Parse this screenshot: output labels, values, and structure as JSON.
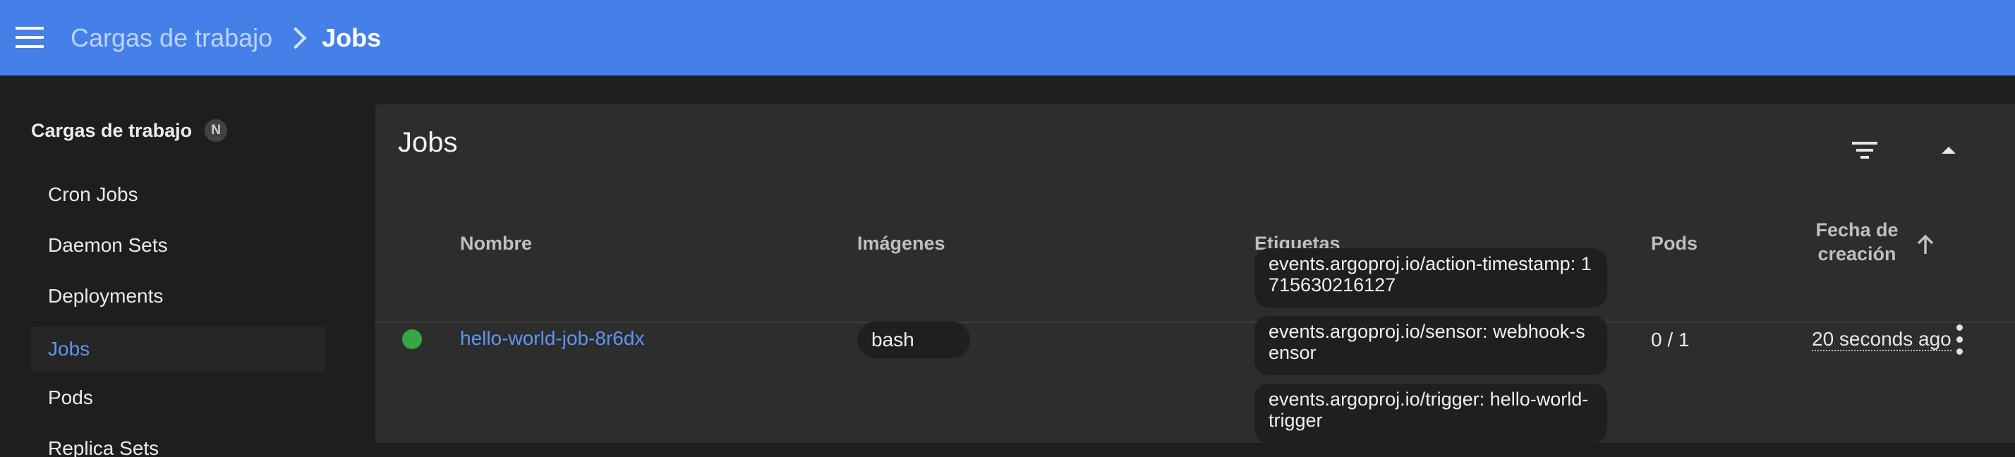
{
  "header": {
    "breadcrumb_parent": "Cargas de trabajo",
    "breadcrumb_current": "Jobs",
    "bar_color": "#4580e8"
  },
  "sidebar": {
    "group_label": "Cargas de trabajo",
    "group_badge": "N",
    "items": [
      {
        "label": "Cron Jobs"
      },
      {
        "label": "Daemon Sets"
      },
      {
        "label": "Deployments"
      },
      {
        "label": "Jobs",
        "active": true
      },
      {
        "label": "Pods"
      },
      {
        "label": "Replica Sets"
      }
    ]
  },
  "card": {
    "title": "Jobs",
    "icons": {
      "filter": "filter-icon",
      "collapse": "chevron-up-icon",
      "sort": "arrow-up-icon",
      "menu": "more-vert-icon"
    }
  },
  "table": {
    "columns": {
      "name": "Nombre",
      "images": "Imágenes",
      "labels": "Etiquetas",
      "pods": "Pods",
      "created_line1": "Fecha de",
      "created_line2": "creación"
    },
    "rows": [
      {
        "status": "running",
        "status_color": "#37a745",
        "name": "hello-world-job-8r6dx",
        "images": [
          "bash"
        ],
        "labels": [
          "events.argoproj.io/action-timestamp: 1715630216127",
          "events.argoproj.io/sensor: webhook-sensor",
          "events.argoproj.io/trigger: hello-world-trigger"
        ],
        "pods": "0 / 1",
        "age": "20 seconds ago"
      }
    ]
  }
}
